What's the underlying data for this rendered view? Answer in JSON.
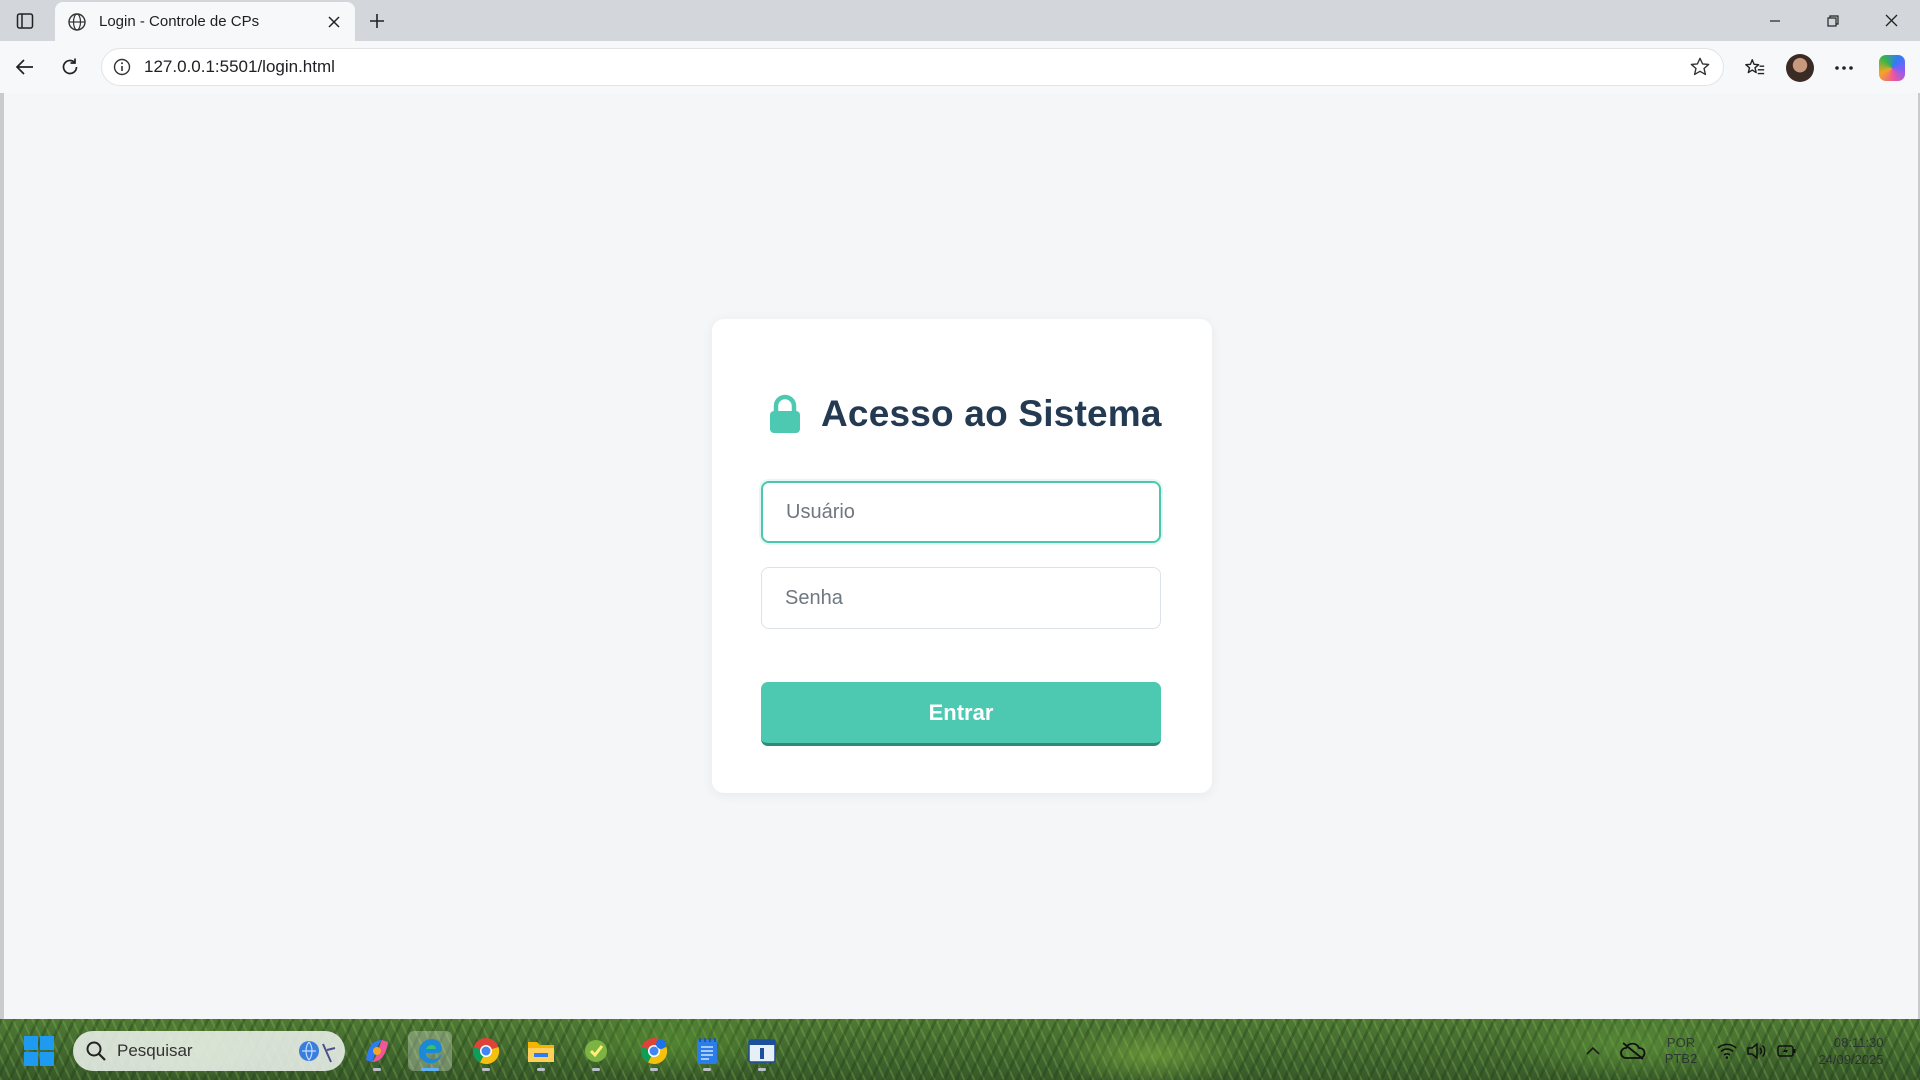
{
  "browser": {
    "tab_title": "Login - Controle de CPs",
    "url": "127.0.0.1:5501/login.html"
  },
  "login": {
    "title": "Acesso ao Sistema",
    "username_placeholder": "Usuário",
    "password_placeholder": "Senha",
    "submit_label": "Entrar",
    "accent_color": "#4cc9b0",
    "title_color": "#233a52"
  },
  "taskbar": {
    "search_placeholder": "Pesquisar",
    "apps": [
      "copilot-app",
      "edge-browser",
      "chrome-browser",
      "file-explorer",
      "app-icon",
      "chrome-profile",
      "notepad",
      "app-window"
    ],
    "lang_line1": "POR",
    "lang_line2": "PTB2",
    "time": "08:11:30",
    "date": "24/09/2025"
  }
}
